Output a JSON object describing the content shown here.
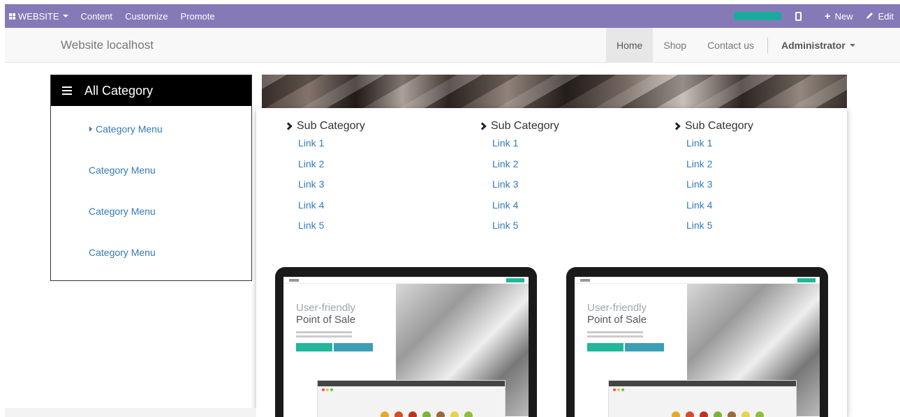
{
  "admin_bar": {
    "website_label": "WEBSITE",
    "menu": [
      "Content",
      "Customize",
      "Promote"
    ],
    "progress_fraction": 1.0,
    "new_label": "New",
    "edit_label": "Edit",
    "color": "#8679b8"
  },
  "navbar": {
    "brand": "Website localhost",
    "items": [
      "Home",
      "Shop",
      "Contact us"
    ],
    "active": "Home",
    "user": "Administrator"
  },
  "category_panel": {
    "title": "All Category",
    "items": [
      "Category Menu",
      "Category Menu",
      "Category Menu",
      "Category Menu"
    ]
  },
  "mega_menu": {
    "columns": [
      {
        "title": "Sub Category",
        "links": [
          "Link 1",
          "Link 2",
          "Link 3",
          "Link 4",
          "Link 5"
        ]
      },
      {
        "title": "Sub Category",
        "links": [
          "Link 1",
          "Link 2",
          "Link 3",
          "Link 4",
          "Link 5"
        ]
      },
      {
        "title": "Sub Category",
        "links": [
          "Link 1",
          "Link 2",
          "Link 3",
          "Link 4",
          "Link 5"
        ]
      }
    ],
    "promo": {
      "headline_line1": "User-friendly",
      "headline_line2": "Point of Sale"
    },
    "link_color": "#337ab7"
  }
}
